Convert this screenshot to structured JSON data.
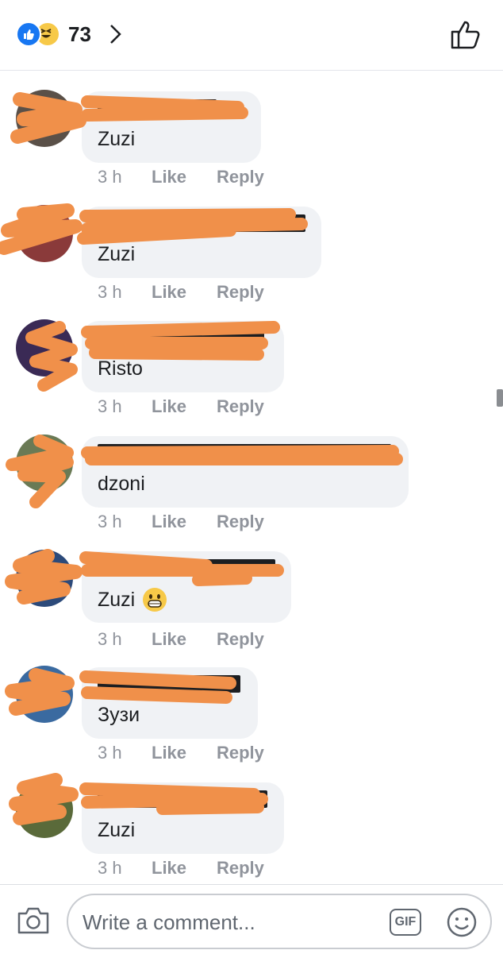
{
  "header": {
    "reaction_count": "73",
    "reaction_icons": [
      "like-reaction-icon",
      "haha-reaction-icon"
    ]
  },
  "comments": [
    {
      "text": "Zuzi",
      "time": "3 h",
      "like": "Like",
      "reply": "Reply"
    },
    {
      "text": "Zuzi",
      "time": "3 h",
      "like": "Like",
      "reply": "Reply"
    },
    {
      "text": "Risto",
      "time": "3 h",
      "like": "Like",
      "reply": "Reply"
    },
    {
      "text": "dzoni",
      "time": "3 h",
      "like": "Like",
      "reply": "Reply"
    },
    {
      "text": "Zuzi",
      "time": "3 h",
      "like": "Like",
      "reply": "Reply",
      "emoji": "grinning-face-emoji"
    },
    {
      "text": "Зузи",
      "time": "3 h",
      "like": "Like",
      "reply": "Reply"
    },
    {
      "text": "Zuzi",
      "time": "3 h",
      "like": "Like",
      "reply": "Reply"
    }
  ],
  "composer": {
    "placeholder": "Write a comment...",
    "gif_label": "GIF"
  },
  "colors": {
    "brand_blue": "#1877f2",
    "bubble_bg": "#f0f2f5",
    "redaction_orange": "#f0904a",
    "meta_gray": "#90949c"
  }
}
